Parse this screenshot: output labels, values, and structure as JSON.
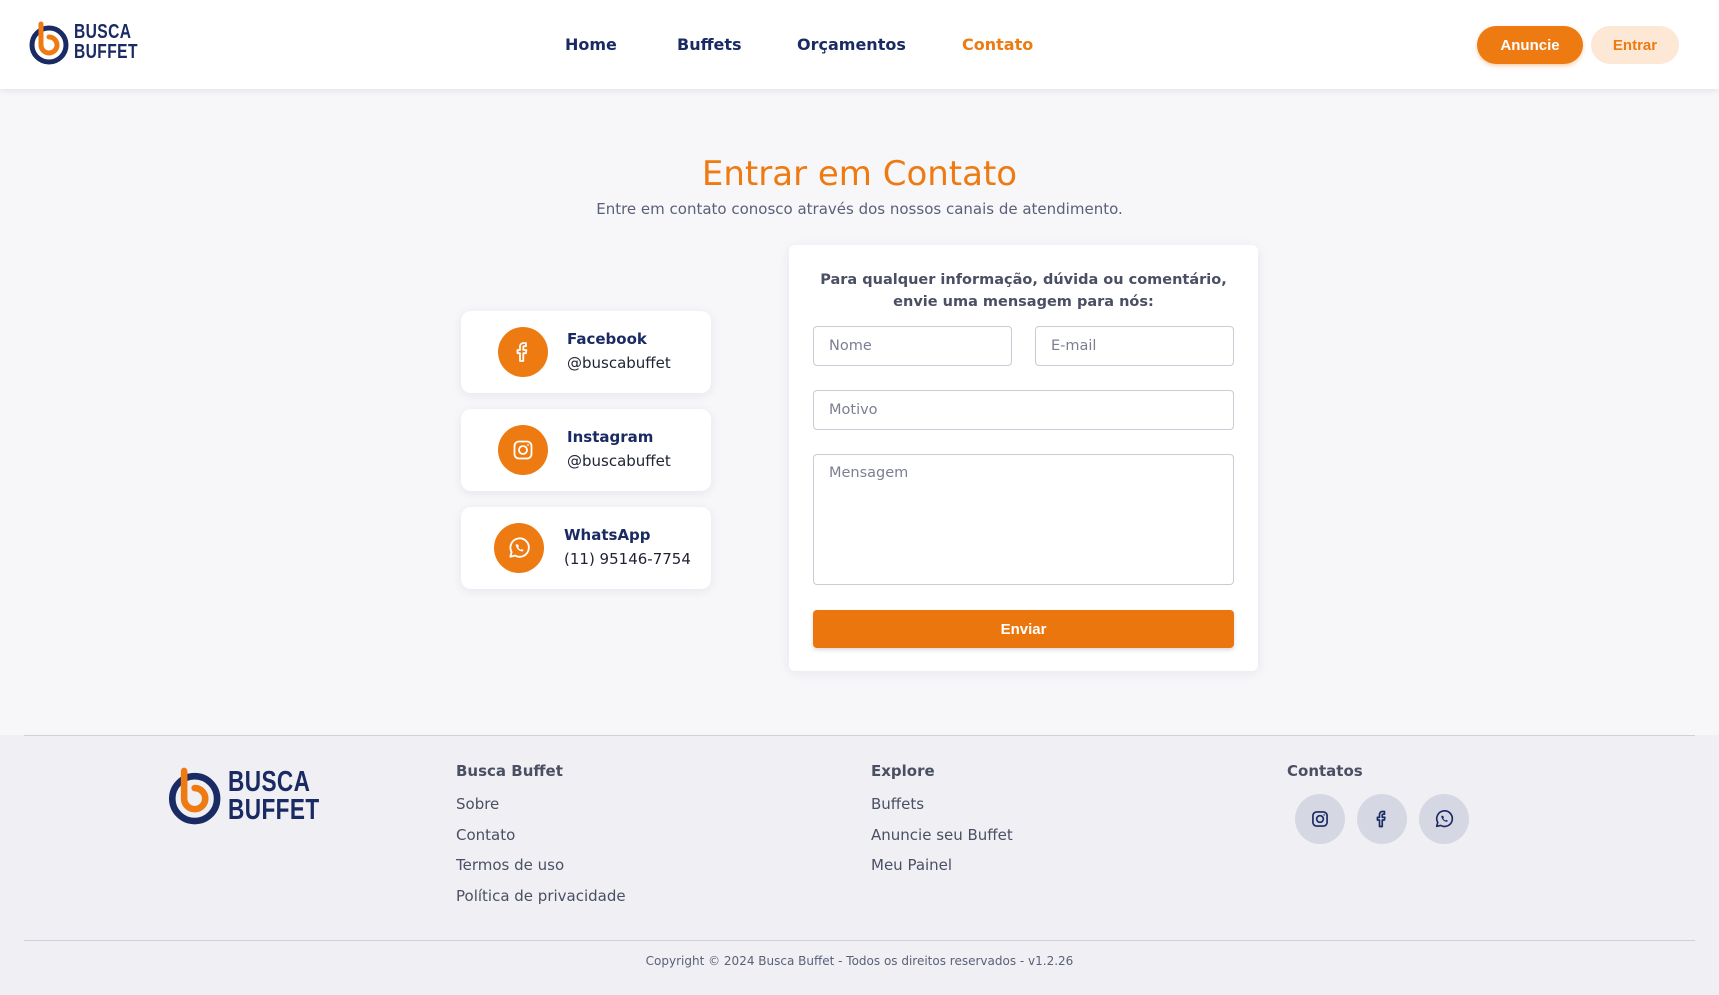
{
  "brand": {
    "line1": "BUSCA",
    "line2": "BUFFET"
  },
  "nav": {
    "items": [
      {
        "label": "Home",
        "active": false
      },
      {
        "label": "Buffets",
        "active": false
      },
      {
        "label": "Orçamentos",
        "active": false
      },
      {
        "label": "Contato",
        "active": true
      }
    ],
    "anuncie_label": "Anuncie",
    "entrar_label": "Entrar"
  },
  "hero": {
    "title": "Entrar em Contato",
    "subtitle": "Entre em contato conosco através dos nossos canais de atendimento."
  },
  "channels": [
    {
      "icon": "facebook-icon",
      "name": "Facebook",
      "value": "@buscabuffet"
    },
    {
      "icon": "instagram-icon",
      "name": "Instagram",
      "value": "@buscabuffet"
    },
    {
      "icon": "whatsapp-icon",
      "name": "WhatsApp",
      "value": "(11) 95146-7754"
    }
  ],
  "form": {
    "intro_line1": "Para qualquer informação, dúvida ou comentário,",
    "intro_line2": "envie uma mensagem para nós:",
    "name_placeholder": "Nome",
    "email_placeholder": "E-mail",
    "reason_placeholder": "Motivo",
    "message_placeholder": "Mensagem",
    "submit_label": "Enviar"
  },
  "footer": {
    "col1": {
      "heading": "Busca Buffet",
      "links": [
        "Sobre",
        "Contato",
        "Termos de uso",
        "Política de privacidade"
      ]
    },
    "col2": {
      "heading": "Explore",
      "links": [
        "Buffets",
        "Anuncie seu Buffet",
        "Meu Painel"
      ]
    },
    "col3": {
      "heading": "Contatos",
      "icons": [
        "instagram-icon",
        "facebook-icon",
        "whatsapp-icon"
      ]
    },
    "copyright": "Copyright © 2024 Busca Buffet - Todos os direitos reservados - v1.2.26"
  },
  "colors": {
    "accent": "#ee7a12",
    "navy": "#1a2a63",
    "background": "#f7f7fa"
  }
}
